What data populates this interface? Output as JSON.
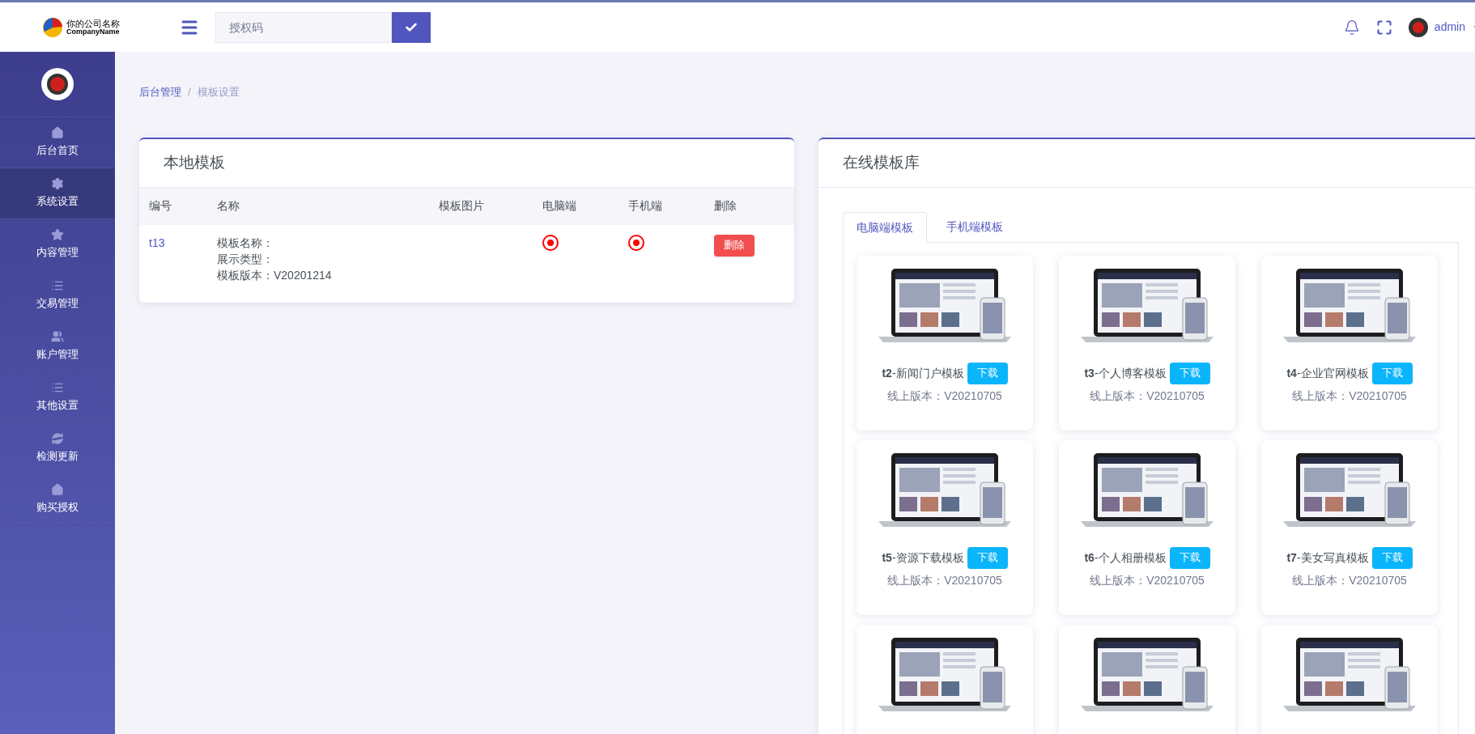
{
  "header": {
    "logo": {
      "name": "你的公司名称",
      "subtitle": "CompanyName"
    },
    "license_field": {
      "placeholder": "授权码"
    },
    "user": {
      "name": "admin"
    }
  },
  "sidebar": {
    "items": [
      {
        "label": "后台首页",
        "selected": false
      },
      {
        "label": "系统设置",
        "selected": true
      },
      {
        "label": "内容管理",
        "selected": false
      },
      {
        "label": "交易管理",
        "selected": false
      },
      {
        "label": "账户管理",
        "selected": false
      },
      {
        "label": "其他设置",
        "selected": false
      },
      {
        "label": "检测更新",
        "selected": false
      },
      {
        "label": "购买授权",
        "selected": false
      }
    ]
  },
  "breadcrumb": {
    "separator": "/",
    "items": [
      "后台管理",
      "模板设置"
    ]
  },
  "local_templates": {
    "title": "本地模板",
    "columns": [
      "编号",
      "名称",
      "模板图片",
      "电脑端",
      "手机端",
      "删除"
    ],
    "rows": [
      {
        "id": "t13",
        "lines": [
          "模板名称：",
          "展示类型：",
          "模板版本：V20201214"
        ],
        "pc": true,
        "mobile": true,
        "action": "删除"
      }
    ]
  },
  "online_library": {
    "title": "在线模板库",
    "tabs": [
      {
        "label": "电脑端模板",
        "selected": true
      },
      {
        "label": "手机端模板",
        "selected": false
      }
    ],
    "cards": [
      {
        "kind": "full",
        "title": "**t2**-新闻门户模板",
        "button": "下载",
        "version": "线上版本：V20210705"
      },
      {
        "kind": "full",
        "title": "**t3**-个人博客模板",
        "button": "下载",
        "version": "线上版本：V20210705"
      },
      {
        "kind": "full",
        "title": "**t4**-企业官网模板",
        "button": "下载",
        "version": "线上版本：V20210705"
      },
      {
        "kind": "full",
        "title": "**t5**-资源下载模板",
        "button": "下载",
        "version": "线上版本：V20210705"
      },
      {
        "kind": "full",
        "title": "**t6**-个人相册模板",
        "button": "下载",
        "version": "线上版本：V20210705"
      },
      {
        "kind": "full",
        "title": "**t7**-美女写真模板",
        "button": "下载",
        "version": "线上版本：V20210705"
      },
      {
        "kind": "partial"
      },
      {
        "kind": "partial"
      },
      {
        "kind": "partial"
      }
    ]
  }
}
